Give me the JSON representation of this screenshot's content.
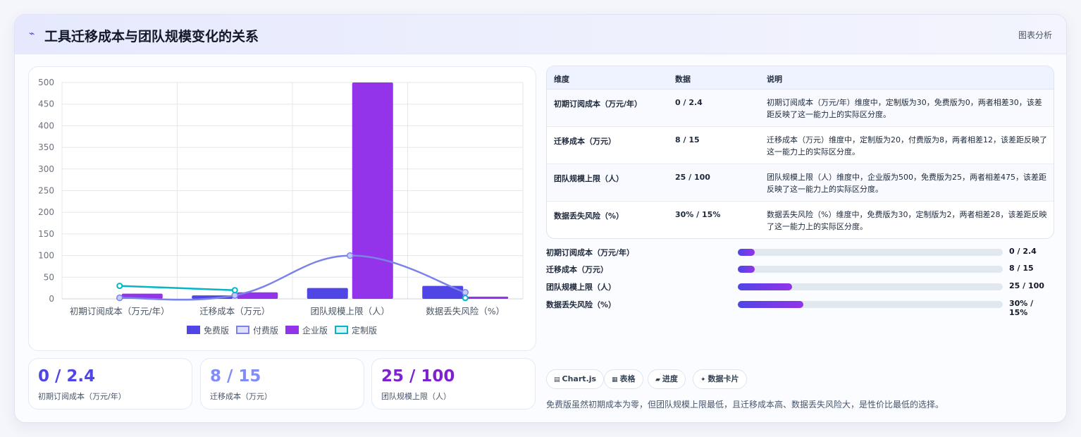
{
  "header": {
    "icon": "⌁",
    "title": "工具迁移成本与团队规模变化的关系",
    "tag": "图表分析"
  },
  "colors": {
    "free": "#4f46e5",
    "paid": "#7c83e8",
    "enterprise": "#9333ea",
    "custom": "#06b6c4"
  },
  "chart_data": {
    "type": "bar",
    "categories": [
      "初期订阅成本（万元/年）",
      "迁移成本（万元）",
      "团队规模上限（人）",
      "数据丢失风险（%）"
    ],
    "series": [
      {
        "name": "免费版",
        "type": "bar",
        "values": [
          0,
          8,
          25,
          30
        ]
      },
      {
        "name": "付费版",
        "type": "line",
        "values": [
          2.4,
          8,
          100,
          15
        ]
      },
      {
        "name": "企业版",
        "type": "bar",
        "values": [
          12,
          15,
          500,
          5
        ]
      },
      {
        "name": "定制版",
        "type": "line",
        "values": [
          30,
          20,
          null,
          2
        ]
      }
    ],
    "ylim": [
      0,
      500
    ],
    "yticks": [
      "0",
      "50",
      "100",
      "150",
      "200",
      "250",
      "300",
      "350",
      "400",
      "450",
      "500"
    ],
    "grid": true,
    "legend": "bottom"
  },
  "stats": [
    {
      "value": "0 / 2.4",
      "label": "初期订阅成本（万元/年）",
      "color": "#4f46e5"
    },
    {
      "value": "8 / 15",
      "label": "迁移成本（万元）",
      "color": "#818cf8"
    },
    {
      "value": "25 / 100",
      "label": "团队规模上限（人）",
      "color": "#7e22ce"
    }
  ],
  "table": {
    "headers": [
      "维度",
      "数据",
      "说明"
    ],
    "rows": [
      {
        "dim": "初期订阅成本（万元/年）",
        "data": "0 / 2.4",
        "desc": "初期订阅成本（万元/年）维度中，定制版为30，免费版为0，两者相差30，该差距反映了这一能力上的实际区分度。"
      },
      {
        "dim": "迁移成本（万元）",
        "data": "8 / 15",
        "desc": "迁移成本（万元）维度中，定制版为20，付费版为8，两者相差12，该差距反映了这一能力上的实际区分度。"
      },
      {
        "dim": "团队规模上限（人）",
        "data": "25 / 100",
        "desc": "团队规模上限（人）维度中，企业版为500，免费版为25，两者相差475，该差距反映了这一能力上的实际区分度。"
      },
      {
        "dim": "数据丢失风险（%）",
        "data": "30% / 15%",
        "desc": "数据丢失风险（%）维度中，免费版为30，定制版为2，两者相差28，该差距反映了这一能力上的实际区分度。"
      }
    ]
  },
  "progress": [
    {
      "label": "初期订阅成本（万元/年）",
      "value": "0 / 2.4",
      "fraction": 0.065
    },
    {
      "label": "迁移成本（万元）",
      "value": "8 / 15",
      "fraction": 0.065
    },
    {
      "label": "团队规模上限（人）",
      "value": "25 / 100",
      "fraction": 0.205
    },
    {
      "label": "数据丢失风险（%）",
      "value": "30% / 15%",
      "fraction": 0.248
    }
  ],
  "chips": [
    {
      "icon": "▤",
      "label": "Chart.js"
    },
    {
      "icon": "▦",
      "label": "表格"
    },
    {
      "icon": "▰",
      "label": "进度"
    },
    {
      "icon": "✦",
      "label": "数据卡片"
    }
  ],
  "summary": "免费版虽然初期成本为零，但团队规模上限最低，且迁移成本高、数据丢失风险大，是性价比最低的选择。"
}
